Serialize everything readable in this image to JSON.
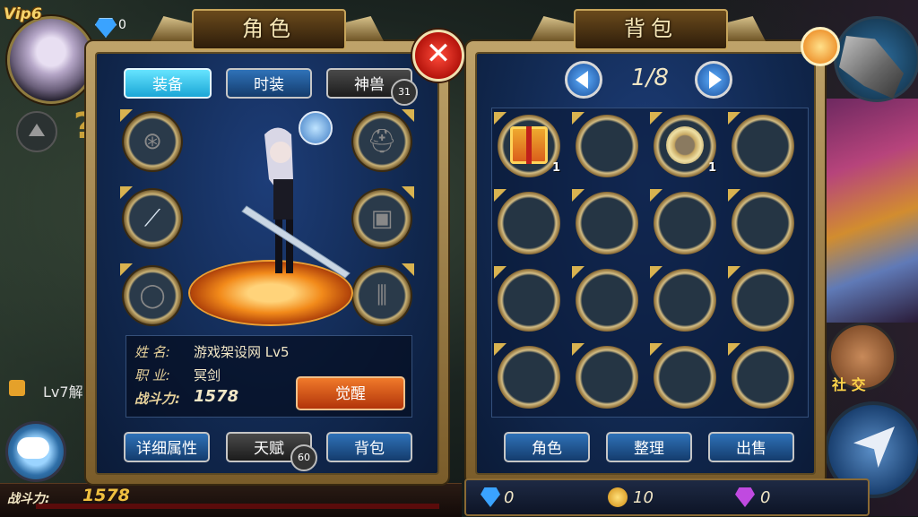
{
  "hud": {
    "vip": "Vip6",
    "gem_count": "0",
    "lock_text": "Lv7解",
    "power_label": "战斗力:",
    "power_value": "1578",
    "social_label": "社 交"
  },
  "role_panel": {
    "title": "角色",
    "tabs": [
      "装备",
      "时装",
      "神兽"
    ],
    "beast_lock_level": "31",
    "info": {
      "name_label": "姓 名:",
      "name_value": "游戏架设网 Lv5",
      "job_label": "职 业:",
      "job_value": "冥剑",
      "power_label": "战斗力:",
      "power_value": "1578"
    },
    "awaken_label": "觉醒",
    "bottom_buttons": [
      "详细属性",
      "天赋",
      "背包"
    ],
    "talent_lock_level": "60"
  },
  "bag_panel": {
    "title": "背包",
    "page": "1/8",
    "slot_qty": [
      "1",
      "1"
    ],
    "buttons": [
      "角色",
      "整理",
      "出售"
    ],
    "currency": {
      "diamond": "0",
      "gold": "10",
      "crystal": "0"
    }
  },
  "colors": {
    "accent_gold": "#d9b350",
    "panel_blue": "#11284f",
    "tab_active": "#1aa6d6",
    "awaken": "#e0561a"
  }
}
